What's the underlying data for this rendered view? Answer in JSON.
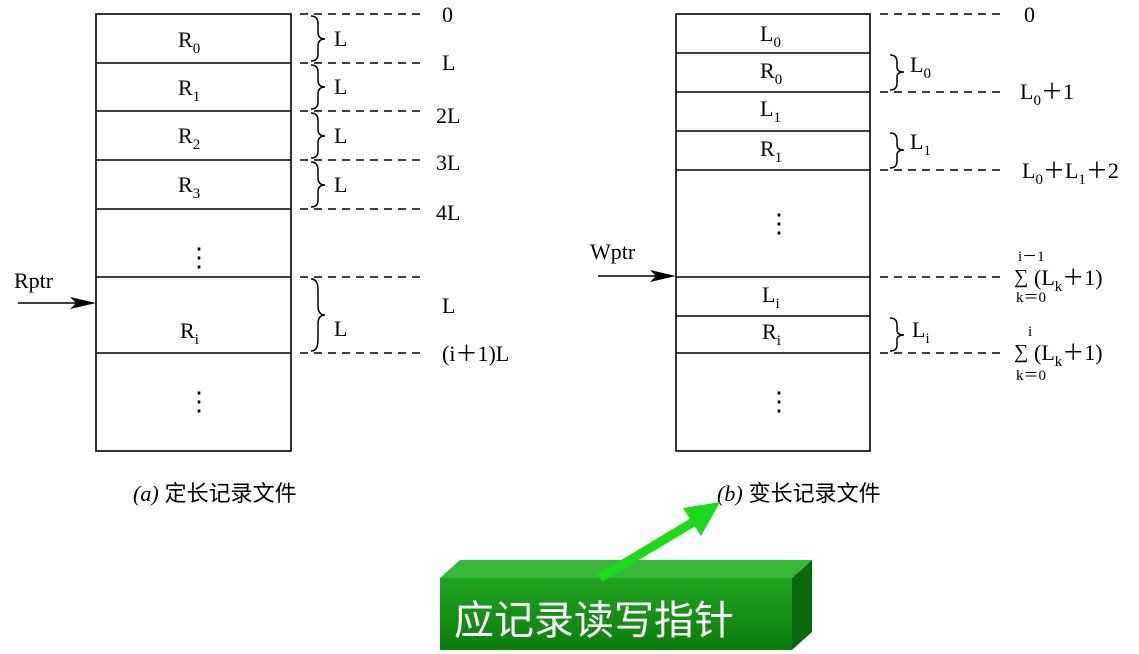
{
  "diagram_a": {
    "records": [
      {
        "base": "R",
        "sub": "0"
      },
      {
        "base": "R",
        "sub": "1"
      },
      {
        "base": "R",
        "sub": "2"
      },
      {
        "base": "R",
        "sub": "3"
      }
    ],
    "record_i": {
      "base": "R",
      "sub": "i"
    },
    "ellipsis": "⋮",
    "brace_label": "L",
    "offsets": [
      "0",
      "L",
      "2L",
      "3L",
      "4L"
    ],
    "offset_i_start": "L",
    "offset_i_end": "(i＋1)L",
    "pointer": "Rptr",
    "caption_letter": "(a)",
    "caption_text": "定长记录文件"
  },
  "diagram_b": {
    "records": [
      {
        "base": "L",
        "sub": "0"
      },
      {
        "base": "R",
        "sub": "0"
      },
      {
        "base": "L",
        "sub": "1"
      },
      {
        "base": "R",
        "sub": "1"
      }
    ],
    "record_li": {
      "base": "L",
      "sub": "i"
    },
    "record_ri": {
      "base": "R",
      "sub": "i"
    },
    "ellipsis": "⋮",
    "brace_r0": {
      "base": "L",
      "sub": "0"
    },
    "brace_r1": {
      "base": "L",
      "sub": "1"
    },
    "brace_ri": {
      "base": "L",
      "sub": "i"
    },
    "offset_0": "0",
    "offset_r0": {
      "a": "L",
      "a_sub": "0",
      "rest": "＋1"
    },
    "offset_r1": {
      "a": "L",
      "a_sub": "0",
      "mid": "＋L",
      "mid_sub": "1",
      "rest": "＋2"
    },
    "sum_li": {
      "upper": "i－1",
      "lower": "k＝0",
      "body": "(L",
      "body_sub": "k",
      "tail": "＋1)",
      "sigma": "∑"
    },
    "sum_ri": {
      "upper": "i",
      "lower": "k＝0",
      "body": "(L",
      "body_sub": "k",
      "tail": "＋1)",
      "sigma": "∑"
    },
    "pointer": "Wptr",
    "caption_letter": "(b)",
    "caption_text": "变长记录文件"
  },
  "banner": {
    "text": "应记录读写指针",
    "color_top": "#2fb32f",
    "color_front": "#0f8f0f",
    "arrow_color": "#1adb1a"
  }
}
